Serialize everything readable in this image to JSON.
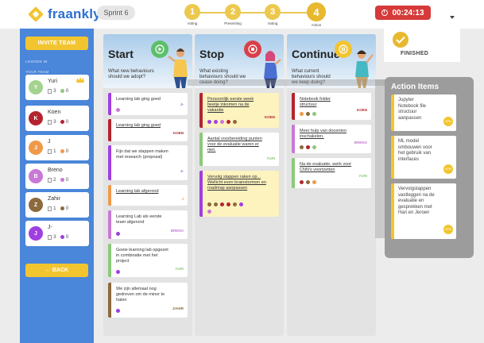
{
  "app": {
    "logo_text": "fraankly"
  },
  "header": {
    "sprint": "Sprint 6",
    "steps": [
      {
        "num": "1",
        "label": "Voting",
        "active": false
      },
      {
        "num": "2",
        "label": "Presenting",
        "active": false
      },
      {
        "num": "3",
        "label": "Voting",
        "active": false
      },
      {
        "num": "4",
        "label": "Action",
        "active": true
      }
    ],
    "timer": "00:24:13"
  },
  "sidebar": {
    "invite_label": "INVITE TEAM",
    "logged_in_label": "LOGGED IN",
    "team_label": "YOUR TEAM",
    "back_label": "← BACK",
    "members": [
      {
        "initial": "Y",
        "name": "Yuri",
        "cards": "3",
        "votes": "0",
        "color": "#a3d38f",
        "dot": "#8cc97a",
        "crown": true
      },
      {
        "initial": "K",
        "name": "Koen",
        "cards": "3",
        "votes": "0",
        "color": "#b3242f",
        "dot": "#b3242f",
        "crown": false
      },
      {
        "initial": "J",
        "name": "J",
        "cards": "1",
        "votes": "0",
        "color": "#ef9a4a",
        "dot": "#ef9a4a",
        "crown": false
      },
      {
        "initial": "B",
        "name": "Breno",
        "cards": "2",
        "votes": "0",
        "color": "#c978d7",
        "dot": "#c978d7",
        "crown": false
      },
      {
        "initial": "Z",
        "name": "Zahir",
        "cards": "1",
        "votes": "0",
        "color": "#8b6a3c",
        "dot": "#8b6a3c",
        "crown": false
      },
      {
        "initial": "J",
        "name": "J-",
        "cards": "3",
        "votes": "0",
        "color": "#9f3fe0",
        "dot": "#9f3fe0",
        "crown": false
      }
    ]
  },
  "columns": {
    "start": {
      "title": "Start",
      "subtitle": "What new behaviours should we adopt?",
      "icon_color": "#5cbf6a",
      "cards": [
        {
          "text": "Learning lab ging goed",
          "author": "J-",
          "author_color": "#9f3fe0",
          "border": "#9f3fe0",
          "votes": [
            "#c978d7"
          ],
          "underline": false
        },
        {
          "text": "Learning lab ging goed",
          "author": "KOEN",
          "author_color": "#b3242f",
          "border": "#b3242f",
          "votes": [],
          "underline": true
        },
        {
          "text": "Fijn dat we stappen maken met research (proposal)",
          "author": "J-",
          "author_color": "#9f3fe0",
          "border": "#9f3fe0",
          "votes": [],
          "underline": false
        },
        {
          "text": "Learning lab afgerond",
          "author": "J",
          "author_color": "#ef9a4a",
          "border": "#ef9a4a",
          "votes": [],
          "underline": true
        },
        {
          "text": "Learning Lab als eerste team afgerond",
          "author": "BRENO",
          "author_color": "#c978d7",
          "border": "#c978d7",
          "votes": [
            "#9f3fe0"
          ],
          "underline": false
        },
        {
          "text": "Goeie learning lab opgezet in combinatie met het project",
          "author": "YURI",
          "author_color": "#8cc97a",
          "border": "#8cc97a",
          "votes": [
            "#9f3fe0"
          ],
          "underline": false
        },
        {
          "text": "We zijn allemaal nog gedreven om de minor te halen",
          "author": "ZAHIR",
          "author_color": "#8b6a3c",
          "border": "#8b6a3c",
          "votes": [
            "#9f3fe0"
          ],
          "underline": false
        }
      ]
    },
    "stop": {
      "title": "Stop",
      "subtitle": "What existing behaviours should we cease doing?",
      "icon_color": "#d8404a",
      "cards": [
        {
          "text": "Persoonlijk eerste week beetje inkomen na de vakantie",
          "author": "KOEN",
          "author_color": "#b3242f",
          "border": "#b3242f",
          "votes": [
            "#9f3fe0",
            "#9f3fe0",
            "#c978d7",
            "#b3242f",
            "#8b6a3c"
          ],
          "underline": false,
          "yellow": true
        },
        {
          "text": "Aantal voorbereiding punten voor de evaluatie waren er niet.",
          "author": "YURI",
          "author_color": "#8cc97a",
          "border": "#8cc97a",
          "votes": [],
          "underline": false,
          "yellow": false
        },
        {
          "text": "Vervolg stappen raken op... Wellicht even brainstormen en roadmap aanpassen",
          "author": "",
          "author_color": "#9f3fe0",
          "border": "#9f3fe0",
          "votes": [
            "#8b6a3c",
            "#8b6a3c",
            "#b3242f",
            "#b3242f",
            "#8b6a3c",
            "#9f3fe0",
            "#c978d7"
          ],
          "underline": false,
          "yellow": true
        }
      ]
    },
    "continue": {
      "title": "Continue",
      "subtitle": "What current behaviours should we keep doing?",
      "icon_color": "#f2c530",
      "cards": [
        {
          "text": "Notebook folder structuur",
          "author": "KOEN",
          "author_color": "#b3242f",
          "border": "#b3242f",
          "votes": [
            "#ef9a4a",
            "#8b6a3c",
            "#8cc97a"
          ],
          "underline": false
        },
        {
          "text": "Meer hulp van docenten inschakelen.",
          "author": "BRENO",
          "author_color": "#c978d7",
          "border": "#c978d7",
          "votes": [
            "#8b6a3c",
            "#b3242f",
            "#8cc97a"
          ],
          "underline": false
        },
        {
          "text": "Na de evaluatie, werk voor CNN's voortzetten",
          "author": "YURI",
          "author_color": "#8cc97a",
          "border": "#8cc97a",
          "votes": [
            "#b3242f",
            "#8b6a3c",
            "#ef9a4a"
          ],
          "underline": false
        }
      ]
    }
  },
  "finished": {
    "label": "FINISHED"
  },
  "action_items": {
    "title": "Action Items",
    "items": [
      {
        "text": "Jupyter Notebook file structuur aanpassen",
        "badge": "KPM"
      },
      {
        "text": "ML model ombouwen voor het gebruik van interfaces",
        "badge": "KPM"
      },
      {
        "text": "Vervolgstappen vastleggen na de evaluatie en gesprekken met Hari en Jeroen",
        "badge": "KPM"
      }
    ]
  }
}
